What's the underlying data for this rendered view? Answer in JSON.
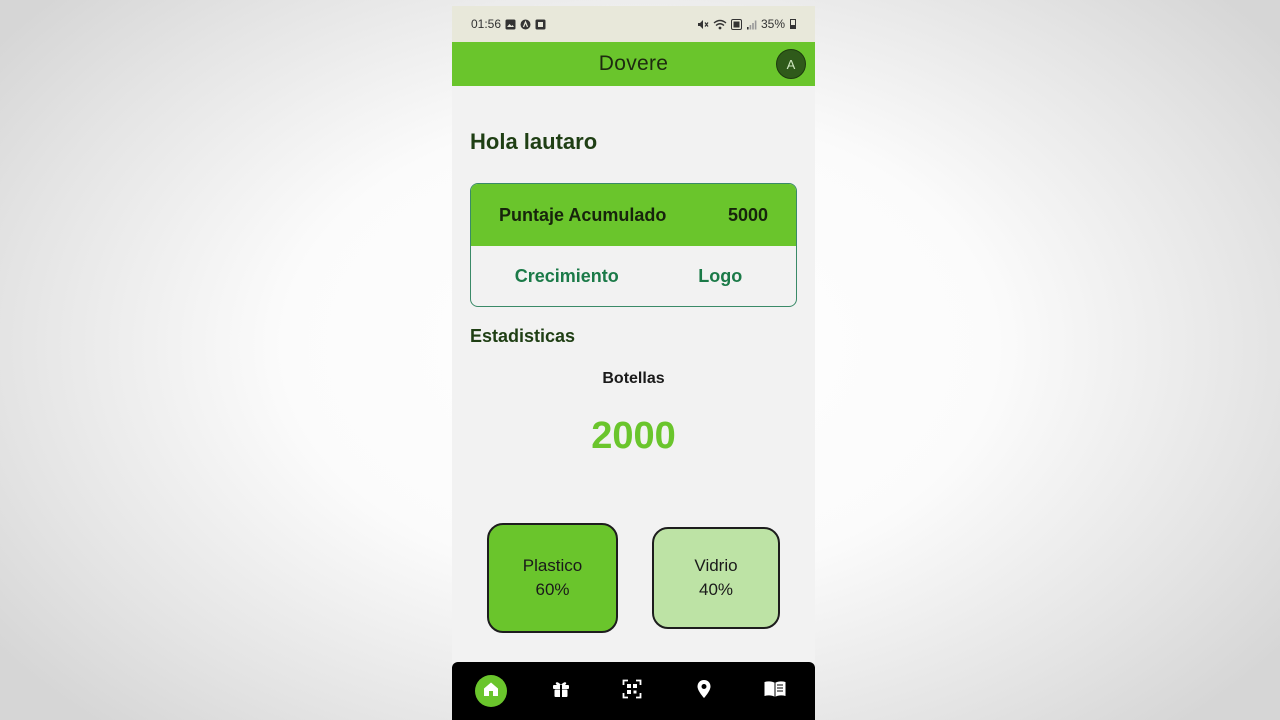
{
  "status_bar": {
    "time": "01:56",
    "battery": "35%"
  },
  "app_bar": {
    "title": "Dovere",
    "avatar_initial": "A"
  },
  "greeting": "Hola lautaro",
  "score_card": {
    "label": "Puntaje Acumulado",
    "value": "5000",
    "links": [
      "Crecimiento",
      "Logo"
    ]
  },
  "stats": {
    "title": "Estadisticas",
    "bottles_label": "Botellas",
    "bottles_value": "2000",
    "materials": [
      {
        "name": "Plastico",
        "percent": "60%"
      },
      {
        "name": "Vidrio",
        "percent": "40%"
      }
    ]
  },
  "bottom_nav": {
    "items": [
      {
        "icon": "home-icon",
        "active": true
      },
      {
        "icon": "gift-icon",
        "active": false
      },
      {
        "icon": "qr-scan-icon",
        "active": false
      },
      {
        "icon": "location-pin-icon",
        "active": false
      },
      {
        "icon": "book-icon",
        "active": false
      }
    ]
  },
  "colors": {
    "accent_green": "#6ac52c",
    "light_green": "#bde3a5",
    "link_green": "#1b7a48",
    "dark_green_text": "#1f3f14"
  }
}
